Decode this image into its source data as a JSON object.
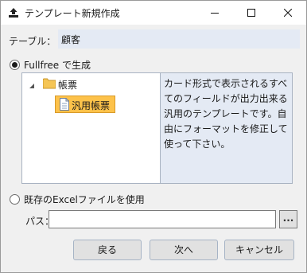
{
  "window": {
    "title": "テンプレート新規作成"
  },
  "table": {
    "label": "テーブル：",
    "value": "顧客"
  },
  "options": {
    "fullfree_label": "Fullfree で生成",
    "fullfree_selected": true,
    "excel_label": "既存のExcelファイルを使用",
    "excel_selected": false
  },
  "tree": {
    "folder_label": "帳票",
    "selected_item_label": "汎用帳票"
  },
  "description": "カード形式で表示されるすべてのフィールドが出力出来る汎用のテンプレートです。自由にフォーマットを修正して使って下さい。",
  "path": {
    "label": "パス：",
    "value": "",
    "browse_label": "..."
  },
  "buttons": {
    "back": "戻る",
    "next": "次へ",
    "cancel": "キャンセル"
  },
  "colors": {
    "selection": "#fdc24a",
    "info_background": "#e4eaf4",
    "folder": "#f5c555",
    "dialog_background": "#f0f0f0"
  },
  "icons": {
    "title": "upload-tray-icon",
    "folder": "folder-icon",
    "document": "document-icon"
  }
}
